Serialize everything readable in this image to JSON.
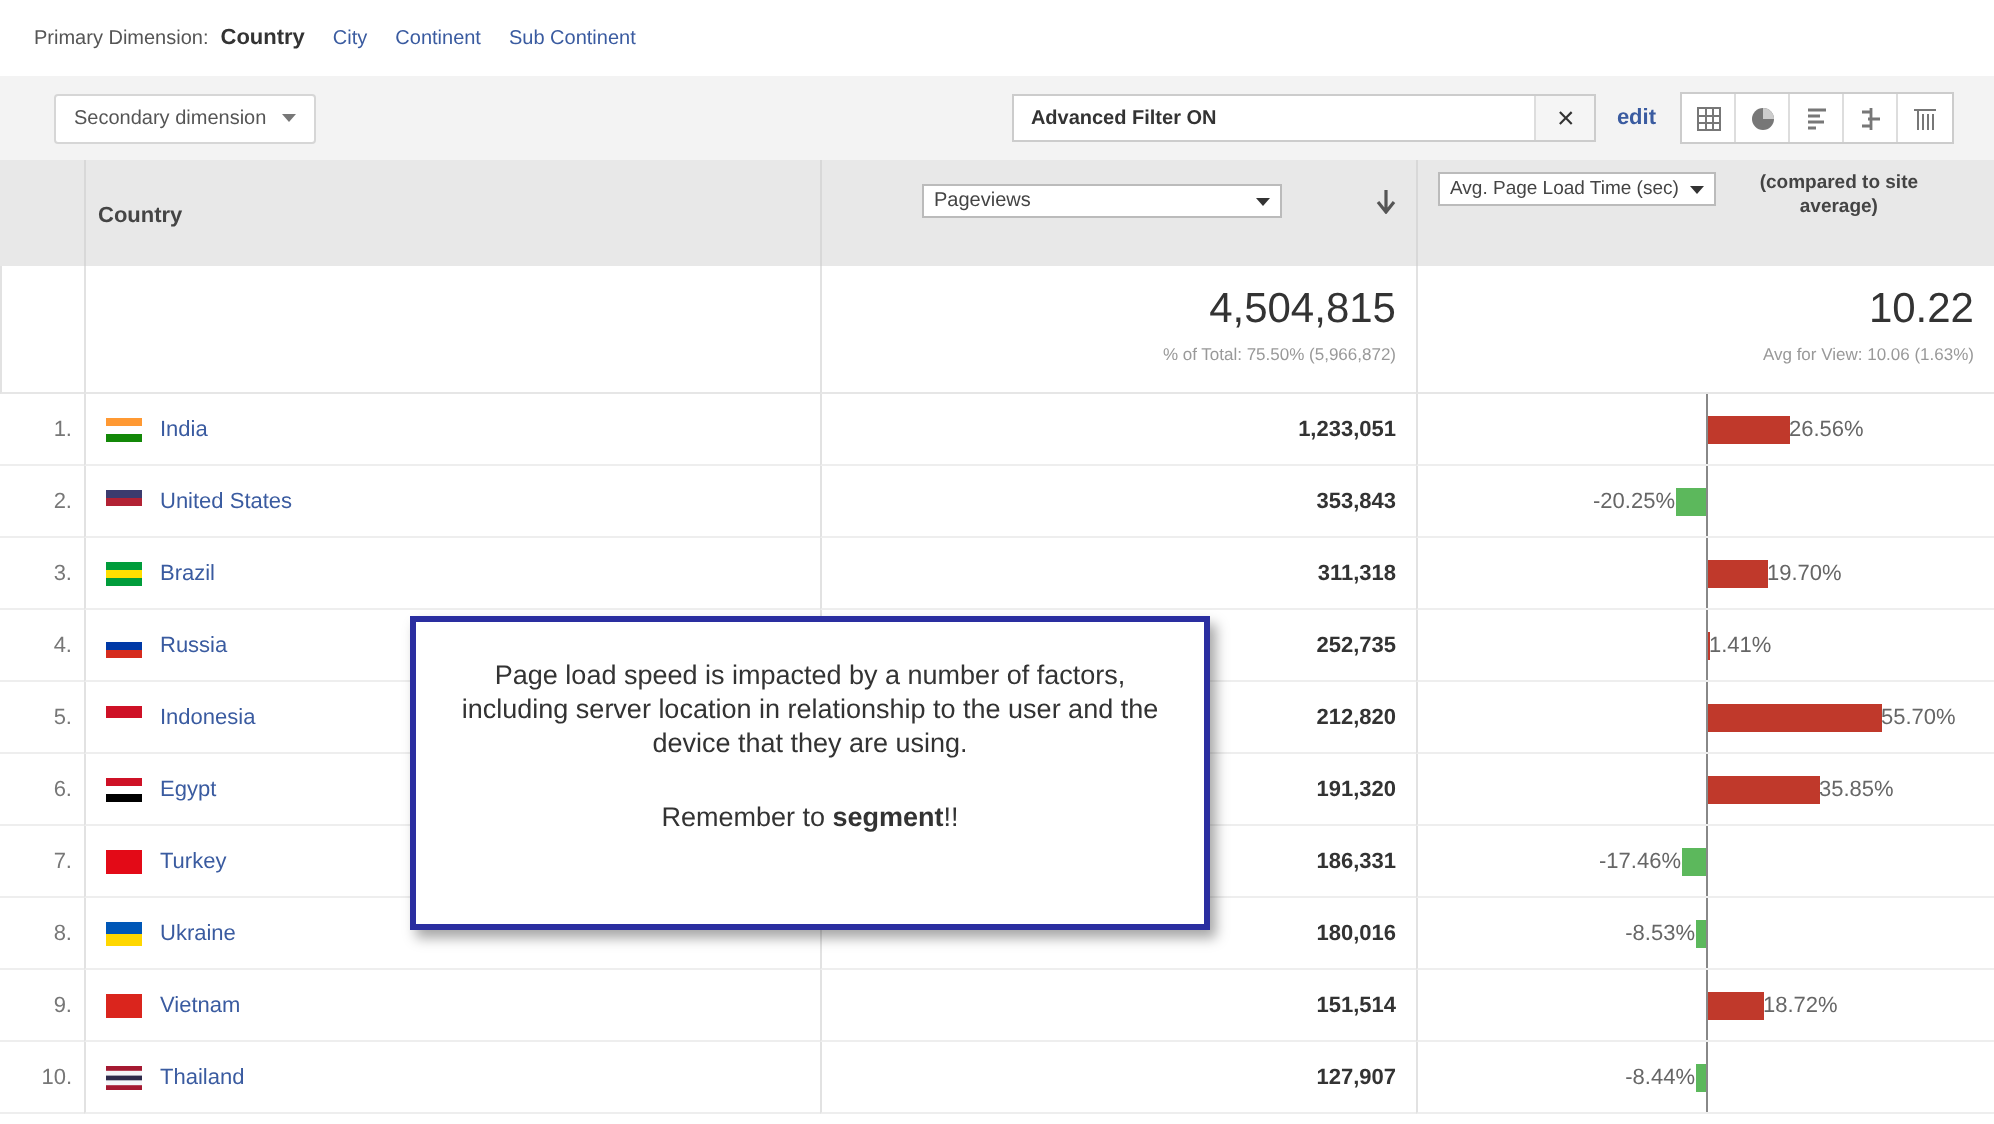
{
  "primary_dimension": {
    "label": "Primary Dimension:",
    "options": [
      {
        "label": "Country",
        "selected": true
      },
      {
        "label": "City",
        "selected": false
      },
      {
        "label": "Continent",
        "selected": false
      },
      {
        "label": "Sub Continent",
        "selected": false
      }
    ]
  },
  "toolbar": {
    "secondary_dimension": "Secondary dimension",
    "filter": {
      "value": "Advanced Filter ON",
      "clear": "×"
    },
    "edit": "edit"
  },
  "table": {
    "columns": [
      {
        "label": "Country"
      },
      {
        "label": "Pageviews"
      },
      {
        "label": "Avg. Page Load Time (sec)",
        "suffix": "(compared to site average)"
      }
    ],
    "totals": {
      "pageviews": "4,504,815",
      "pageviews_note": "% of Total: 75.50% (5,966,872)",
      "load_time": "10.22",
      "load_time_note": "Avg for View: 10.06 (1.63%)"
    },
    "rows": [
      {
        "index": "1.",
        "country": "India",
        "pageviews": "1,233,051",
        "comparison": "26.56%",
        "kind": "above"
      },
      {
        "index": "2.",
        "country": "United States",
        "pageviews": "353,843",
        "comparison": "-20.25%",
        "kind": "below"
      },
      {
        "index": "3.",
        "country": "Brazil",
        "pageviews": "311,318",
        "comparison": "19.70%",
        "kind": "above"
      },
      {
        "index": "4.",
        "country": "Russia",
        "pageviews": "252,735",
        "comparison": "1.41%",
        "kind": "above"
      },
      {
        "index": "5.",
        "country": "Indonesia",
        "pageviews": "212,820",
        "comparison": "55.70%",
        "kind": "above"
      },
      {
        "index": "6.",
        "country": "Egypt",
        "pageviews": "191,320",
        "comparison": "35.85%",
        "kind": "above"
      },
      {
        "index": "7.",
        "country": "Turkey",
        "pageviews": "186,331",
        "comparison": "-17.46%",
        "kind": "below"
      },
      {
        "index": "8.",
        "country": "Ukraine",
        "pageviews": "180,016",
        "comparison": "-8.53%",
        "kind": "below"
      },
      {
        "index": "9.",
        "country": "Vietnam",
        "pageviews": "151,514",
        "comparison": "18.72%",
        "kind": "above"
      },
      {
        "index": "10.",
        "country": "Thailand",
        "pageviews": "127,907",
        "comparison": "-8.44%",
        "kind": "below"
      }
    ]
  },
  "callout": {
    "text": "Page load speed is impacted by a number of factors, including server location in relationship to the user and the device that they are using.",
    "note": "Remember to **segment**!!"
  }
}
